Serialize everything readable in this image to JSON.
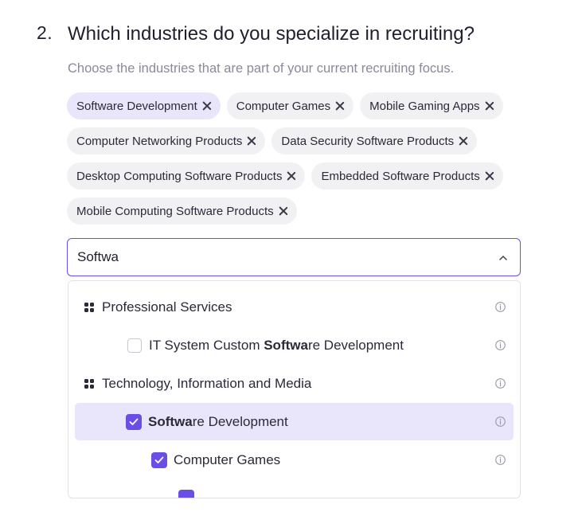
{
  "question": {
    "number": "2.",
    "title": "Which industries do you specialize in recruiting?",
    "subtitle": "Choose the industries that are part of your current recruiting focus."
  },
  "chips": [
    {
      "label": "Software Development",
      "selected": true
    },
    {
      "label": "Computer Games",
      "selected": false
    },
    {
      "label": "Mobile Gaming Apps",
      "selected": false
    },
    {
      "label": "Computer Networking Products",
      "selected": false
    },
    {
      "label": "Data Security Software Products",
      "selected": false
    },
    {
      "label": "Desktop Computing Software Products",
      "selected": false
    },
    {
      "label": "Embedded Software Products",
      "selected": false
    },
    {
      "label": "Mobile Computing Software Products",
      "selected": false
    }
  ],
  "search": {
    "value": "Softwa"
  },
  "dropdown": {
    "groups": [
      {
        "label": "Professional Services",
        "items": [
          {
            "match": "Softwa",
            "before": "IT System Custom ",
            "after": "re Development",
            "checked": false
          }
        ]
      },
      {
        "label": "Technology, Information and Media",
        "items": [
          {
            "match": "Softwa",
            "before": "",
            "after": "re Development",
            "checked": true
          },
          {
            "label": "Computer Games",
            "checked": true
          }
        ]
      }
    ]
  },
  "colors": {
    "accent": "#6b4ee6",
    "chip_bg": "#f1f1f4",
    "chip_selected_bg": "#e9e6fb",
    "highlight_bg": "#e9e6fb"
  },
  "icons": {
    "chip_remove": "close-icon",
    "search_toggle": "chevron-up-icon",
    "group": "grid-icon",
    "info": "info-icon",
    "checked": "checkmark-icon"
  }
}
